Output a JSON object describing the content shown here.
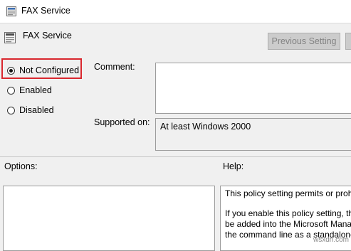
{
  "window": {
    "title": "FAX Service"
  },
  "header": {
    "title": "FAX Service",
    "prev_button": "Previous Setting",
    "next_button": ""
  },
  "state": {
    "options": [
      {
        "label": "Not Configured",
        "checked": true
      },
      {
        "label": "Enabled",
        "checked": false
      },
      {
        "label": "Disabled",
        "checked": false
      }
    ]
  },
  "comment": {
    "label": "Comment:",
    "value": ""
  },
  "supported": {
    "label": "Supported on:",
    "value": "At least Windows 2000"
  },
  "options_section": {
    "label": "Options:"
  },
  "help_section": {
    "label": "Help:",
    "lines": [
      "This policy setting permits or proh",
      "",
      "If you enable this policy setting, th",
      "be added into the Microsoft Mana",
      "the command line as a standalone"
    ]
  },
  "watermark": "wsxdn.com",
  "colors": {
    "highlight": "#d9272e",
    "background": "#f0f0f0",
    "disabled_text": "#838383"
  }
}
